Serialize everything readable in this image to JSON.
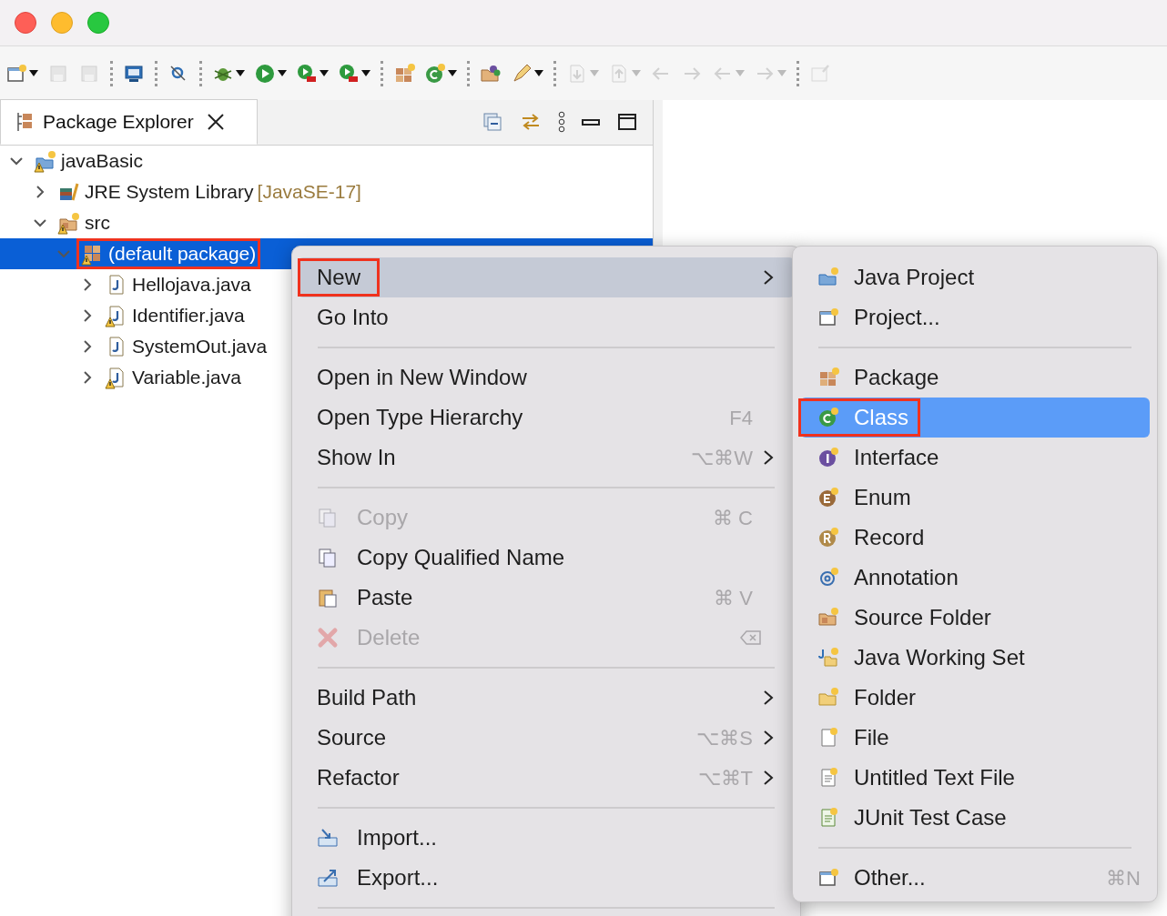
{
  "toolbar": [
    {
      "disabled": false,
      "dropdown": true
    },
    {
      "disabled": true,
      "dropdown": false
    },
    {
      "disabled": true,
      "dropdown": false
    },
    {
      "separator": true
    },
    {
      "disabled": false,
      "dropdown": false
    },
    {
      "separator": true
    },
    {
      "disabled": false,
      "dropdown": false
    },
    {
      "separator": true
    },
    {
      "disabled": false,
      "dropdown": true
    },
    {
      "disabled": false,
      "dropdown": true
    },
    {
      "disabled": false,
      "dropdown": true
    },
    {
      "disabled": false,
      "dropdown": true
    },
    {
      "separator": true
    },
    {
      "disabled": false,
      "dropdown": false
    },
    {
      "disabled": false,
      "dropdown": true
    },
    {
      "separator": true
    },
    {
      "disabled": false,
      "dropdown": false
    },
    {
      "disabled": false,
      "dropdown": true
    },
    {
      "separator": true
    },
    {
      "disabled": true,
      "dropdown": true
    },
    {
      "disabled": true,
      "dropdown": true
    },
    {
      "disabled": true,
      "dropdown": false
    },
    {
      "disabled": true,
      "dropdown": false
    },
    {
      "disabled": true,
      "dropdown": true
    },
    {
      "disabled": true,
      "dropdown": true
    },
    {
      "separator": true
    },
    {
      "disabled": true,
      "dropdown": false
    }
  ],
  "view": {
    "tab": {
      "label": "Package Explorer",
      "selected": true
    }
  },
  "tree": [
    {
      "label": "javaBasic",
      "expanded": true,
      "selected": false,
      "warning": true,
      "children": [
        {
          "label": "JRE System Library",
          "decoration": "[JavaSE-17]",
          "expanded": false,
          "selected": false,
          "warning": false
        },
        {
          "label": "src",
          "expanded": true,
          "selected": false,
          "warning": true,
          "children": [
            {
              "label": "(default package)",
              "expanded": true,
              "selected": true,
              "warning": true,
              "annotated": true,
              "children": [
                {
                  "label": "Hellojava.java",
                  "expanded": false,
                  "selected": false,
                  "warning": false
                },
                {
                  "label": "Identifier.java",
                  "expanded": false,
                  "selected": false,
                  "warning": true
                },
                {
                  "label": "SystemOut.java",
                  "expanded": false,
                  "selected": false,
                  "warning": false
                },
                {
                  "label": "Variable.java",
                  "expanded": false,
                  "selected": false,
                  "warning": true
                }
              ]
            }
          ]
        }
      ]
    }
  ],
  "context_menu": [
    {
      "kind": "item",
      "label": "New",
      "submenu": true,
      "selected": true,
      "annotated": true,
      "disabled": false
    },
    {
      "kind": "item",
      "label": "Go Into",
      "submenu": false,
      "selected": false,
      "disabled": false
    },
    {
      "kind": "separator"
    },
    {
      "kind": "item",
      "label": "Open in New Window",
      "submenu": false,
      "selected": false,
      "disabled": false
    },
    {
      "kind": "item",
      "label": "Open Type Hierarchy",
      "shortcut": "F4",
      "submenu": false,
      "selected": false,
      "disabled": false
    },
    {
      "kind": "item",
      "label": "Show In",
      "shortcut": "⌥⌘W",
      "submenu": true,
      "selected": false,
      "disabled": false
    },
    {
      "kind": "separator"
    },
    {
      "kind": "item",
      "label": "Copy",
      "shortcut": "⌘ C",
      "submenu": false,
      "selected": false,
      "disabled": true
    },
    {
      "kind": "item",
      "label": "Copy Qualified Name",
      "submenu": false,
      "selected": false,
      "disabled": false
    },
    {
      "kind": "item",
      "label": "Paste",
      "shortcut": "⌘ V",
      "submenu": false,
      "selected": false,
      "disabled": false
    },
    {
      "kind": "item",
      "label": "Delete",
      "submenu": false,
      "selected": false,
      "disabled": true
    },
    {
      "kind": "separator"
    },
    {
      "kind": "item",
      "label": "Build Path",
      "submenu": true,
      "selected": false,
      "disabled": false
    },
    {
      "kind": "item",
      "label": "Source",
      "shortcut": "⌥⌘S",
      "submenu": true,
      "selected": false,
      "disabled": false
    },
    {
      "kind": "item",
      "label": "Refactor",
      "shortcut": "⌥⌘T",
      "submenu": true,
      "selected": false,
      "disabled": false
    },
    {
      "kind": "separator"
    },
    {
      "kind": "item",
      "label": "Import...",
      "submenu": false,
      "selected": false,
      "disabled": false
    },
    {
      "kind": "item",
      "label": "Export...",
      "submenu": false,
      "selected": false,
      "disabled": false
    },
    {
      "kind": "separator"
    }
  ],
  "submenu": [
    {
      "kind": "item",
      "label": "Java Project",
      "selected": false
    },
    {
      "kind": "item",
      "label": "Project...",
      "selected": false
    },
    {
      "kind": "separator"
    },
    {
      "kind": "item",
      "label": "Package",
      "selected": false
    },
    {
      "kind": "item",
      "label": "Class",
      "selected": true,
      "annotated": true
    },
    {
      "kind": "item",
      "label": "Interface",
      "selected": false
    },
    {
      "kind": "item",
      "label": "Enum",
      "selected": false
    },
    {
      "kind": "item",
      "label": "Record",
      "selected": false
    },
    {
      "kind": "item",
      "label": "Annotation",
      "selected": false
    },
    {
      "kind": "item",
      "label": "Source Folder",
      "selected": false
    },
    {
      "kind": "item",
      "label": "Java Working Set",
      "selected": false
    },
    {
      "kind": "item",
      "label": "Folder",
      "selected": false
    },
    {
      "kind": "item",
      "label": "File",
      "selected": false
    },
    {
      "kind": "item",
      "label": "Untitled Text File",
      "selected": false
    },
    {
      "kind": "item",
      "label": "JUnit Test Case",
      "selected": false
    },
    {
      "kind": "separator"
    },
    {
      "kind": "item",
      "label": "Other...",
      "shortcut": "⌘N",
      "selected": false
    }
  ]
}
